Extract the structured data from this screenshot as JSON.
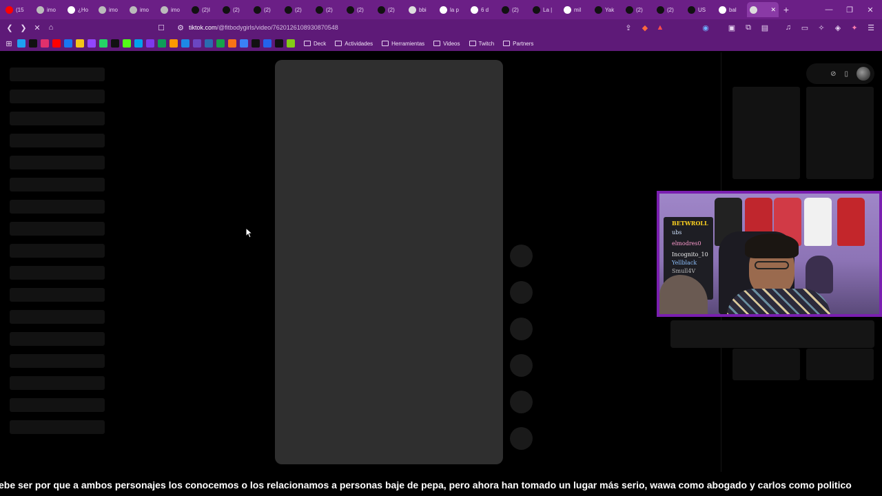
{
  "browser": {
    "tabs": [
      {
        "label": "(15",
        "icon": "youtube-icon",
        "color": "#ff0000"
      },
      {
        "label": "imo",
        "icon": "globe-icon",
        "color": "#bbbbbb"
      },
      {
        "label": "¿Ho",
        "icon": "threads-icon",
        "color": "#ffffff"
      },
      {
        "label": "imo",
        "icon": "globe-icon",
        "color": "#bbbbbb"
      },
      {
        "label": "imo",
        "icon": "globe-icon",
        "color": "#bbbbbb"
      },
      {
        "label": "imo",
        "icon": "globe-icon",
        "color": "#bbbbbb"
      },
      {
        "label": "(2)I",
        "icon": "tiktok-icon",
        "color": "#111111"
      },
      {
        "label": "(2)",
        "icon": "x-icon",
        "color": "#111111"
      },
      {
        "label": "(2)",
        "icon": "x-icon",
        "color": "#111111"
      },
      {
        "label": "(2)",
        "icon": "x-icon",
        "color": "#111111"
      },
      {
        "label": "(2)",
        "icon": "x-icon",
        "color": "#111111"
      },
      {
        "label": "(2)",
        "icon": "x-icon",
        "color": "#111111"
      },
      {
        "label": "(2)",
        "icon": "x-icon",
        "color": "#111111"
      },
      {
        "label": "bbi",
        "icon": "globe-icon",
        "color": "#dddddd"
      },
      {
        "label": "la p",
        "icon": "google-icon",
        "color": "#ffffff"
      },
      {
        "label": "6 d",
        "icon": "app-icon",
        "color": "#ffffff"
      },
      {
        "label": "(2)",
        "icon": "tiktok-icon",
        "color": "#111111"
      },
      {
        "label": "La |",
        "icon": "tiktok-icon",
        "color": "#111111"
      },
      {
        "label": "mil",
        "icon": "google-icon",
        "color": "#ffffff"
      },
      {
        "label": "Yak",
        "icon": "tiktok-icon",
        "color": "#111111"
      },
      {
        "label": "(2)",
        "icon": "tiktok-icon",
        "color": "#111111"
      },
      {
        "label": "(2)",
        "icon": "tiktok-icon",
        "color": "#111111"
      },
      {
        "label": "US",
        "icon": "tiktok-icon",
        "color": "#111111"
      },
      {
        "label": "bal",
        "icon": "google-icon",
        "color": "#ffffff"
      },
      {
        "label": "",
        "icon": "loading-icon",
        "color": "#dddddd",
        "active": true
      }
    ],
    "address": {
      "host": "tiktok.com",
      "path": "/@fitbodygirls/video/7620126108930870548"
    },
    "bookmarks_folders": [
      "Deck",
      "Actividades",
      "Herramientas",
      "Videos",
      "Twitch",
      "Partners"
    ],
    "bookmark_colors": [
      "#1da1f2",
      "#111111",
      "#e1306c",
      "#ff0000",
      "#1877f2",
      "#f5c518",
      "#9146ff",
      "#25d366",
      "#111111",
      "#53fc18",
      "#00a2ed",
      "#7c3aed",
      "#0f9d58",
      "#ff9900",
      "#1e88e5",
      "#6b46c1",
      "#2b6cb0",
      "#16a34a",
      "#f97316",
      "#3b82f6",
      "#111111",
      "#2563eb",
      "#111111",
      "#84cc16"
    ]
  },
  "webcam": {
    "board_lines": [
      "BETWROLL",
      "ubs",
      "elmodres0",
      "Incognito_10",
      "Yellblack",
      "Smull4V"
    ]
  },
  "subtitle": "ebe ser por que a ambos personajes los conocemos o los relacionamos a personas baje de pepa, pero ahora han tomado un lugar más serio, wawa como abogado y carlos como politico"
}
